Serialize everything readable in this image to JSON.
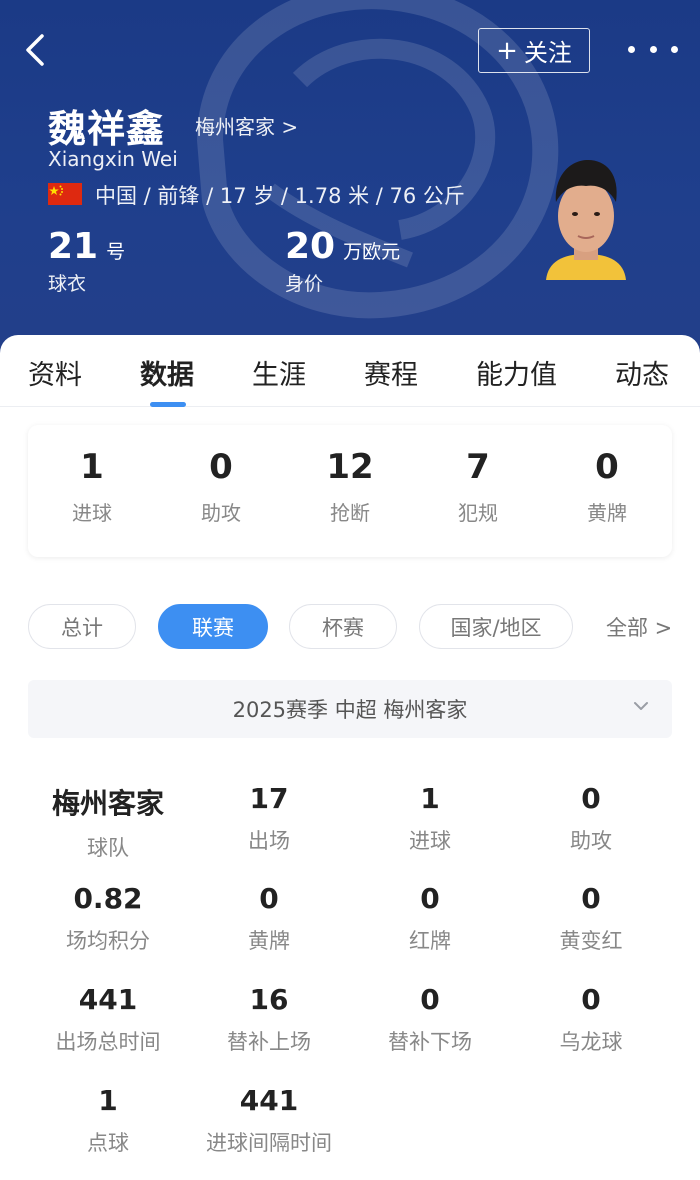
{
  "header": {
    "follow_label": "关注",
    "name_cn": "魏祥鑫",
    "club_link": "梅州客家 >",
    "name_en": "Xiangxin Wei",
    "info": "中国 / 前锋 / 17 岁 / 1.78 米 / 76 公斤",
    "shirt_number": "21",
    "shirt_unit": "号",
    "shirt_label": "球衣",
    "value": "20",
    "value_unit": "万欧元",
    "value_label": "身价",
    "flag_colors": {
      "red": "#de2910",
      "star": "#ffde00"
    }
  },
  "tabs": [
    "资料",
    "数据",
    "生涯",
    "赛程",
    "能力值",
    "动态"
  ],
  "active_tab": "数据",
  "summary": [
    {
      "value": "1",
      "label": "进球"
    },
    {
      "value": "0",
      "label": "助攻"
    },
    {
      "value": "12",
      "label": "抢断"
    },
    {
      "value": "7",
      "label": "犯规"
    },
    {
      "value": "0",
      "label": "黄牌"
    }
  ],
  "filters": [
    "总计",
    "联赛",
    "杯赛",
    "国家/地区"
  ],
  "active_filter": "联赛",
  "filter_all": "全部 >",
  "season": "2025赛季 中超 梅州客家",
  "stats": [
    {
      "value": "梅州客家",
      "label": "球队"
    },
    {
      "value": "17",
      "label": "出场"
    },
    {
      "value": "1",
      "label": "进球"
    },
    {
      "value": "0",
      "label": "助攻"
    },
    {
      "value": "0.82",
      "label": "场均积分"
    },
    {
      "value": "0",
      "label": "黄牌"
    },
    {
      "value": "0",
      "label": "红牌"
    },
    {
      "value": "0",
      "label": "黄变红"
    },
    {
      "value": "441",
      "label": "出场总时间"
    },
    {
      "value": "16",
      "label": "替补上场"
    },
    {
      "value": "0",
      "label": "替补下场"
    },
    {
      "value": "0",
      "label": "乌龙球"
    },
    {
      "value": "1",
      "label": "点球"
    },
    {
      "value": "441",
      "label": "进球间隔时间"
    }
  ],
  "colors": {
    "header_bg": "#1f3f8c",
    "accent": "#3d8ff2"
  }
}
